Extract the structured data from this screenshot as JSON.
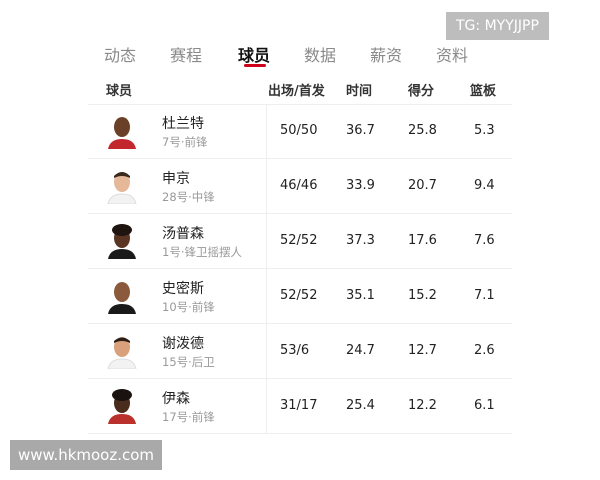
{
  "tabs": [
    {
      "label": "动态",
      "active": false
    },
    {
      "label": "赛程",
      "active": false
    },
    {
      "label": "球员",
      "active": true
    },
    {
      "label": "数据",
      "active": false
    },
    {
      "label": "薪资",
      "active": false
    },
    {
      "label": "资料",
      "active": false
    }
  ],
  "table": {
    "headers": [
      "球员",
      "出场/首发",
      "时间",
      "得分",
      "篮板"
    ],
    "rows": [
      {
        "name": "杜兰特",
        "sub": "7号·前锋",
        "games": "50/50",
        "time": "36.7",
        "pts": "25.8",
        "reb": "5.3"
      },
      {
        "name": "申京",
        "sub": "28号·中锋",
        "games": "46/46",
        "time": "33.9",
        "pts": "20.7",
        "reb": "9.4"
      },
      {
        "name": "汤普森",
        "sub": "1号·锋卫摇摆人",
        "games": "52/52",
        "time": "37.3",
        "pts": "17.6",
        "reb": "7.6"
      },
      {
        "name": "史密斯",
        "sub": "10号·前锋",
        "games": "52/52",
        "time": "35.1",
        "pts": "15.2",
        "reb": "7.1"
      },
      {
        "name": "谢泼德",
        "sub": "15号·后卫",
        "games": "53/6",
        "time": "24.7",
        "pts": "12.7",
        "reb": "2.6"
      },
      {
        "name": "伊森",
        "sub": "17号·前锋",
        "games": "31/17",
        "time": "25.4",
        "pts": "12.2",
        "reb": "6.1"
      }
    ]
  },
  "watermarks": {
    "top": "TG: MYYJJPP",
    "bottom": "www.hkmooz.com"
  },
  "colors": {
    "accent": "#d0021b",
    "muted": "#999999"
  }
}
